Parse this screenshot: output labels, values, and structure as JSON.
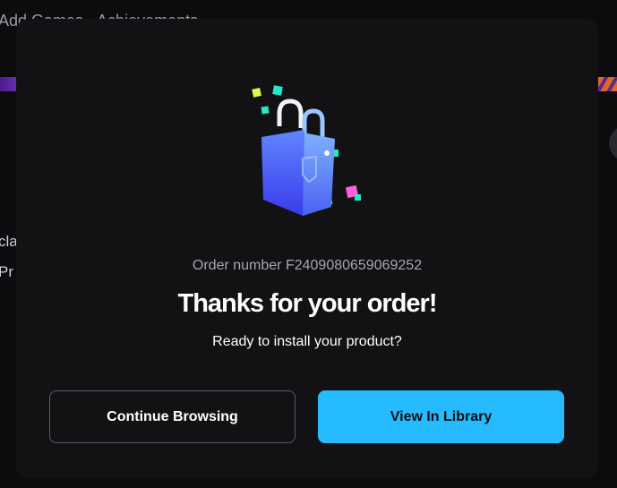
{
  "background": {
    "top_text": "Add Games · Achievements",
    "side_text_1": "cla",
    "side_text_2": "Pr"
  },
  "modal": {
    "illustration_icon": "shopping-bag-icon",
    "order_number": "Order number F2409080659069252",
    "title": "Thanks for your order!",
    "subtitle": "Ready to install your product?",
    "buttons": {
      "continue_label": "Continue Browsing",
      "library_label": "View In Library"
    }
  },
  "colors": {
    "accent": "#26bbff",
    "modal_bg": "#121215",
    "page_bg": "#0c0c0e"
  }
}
